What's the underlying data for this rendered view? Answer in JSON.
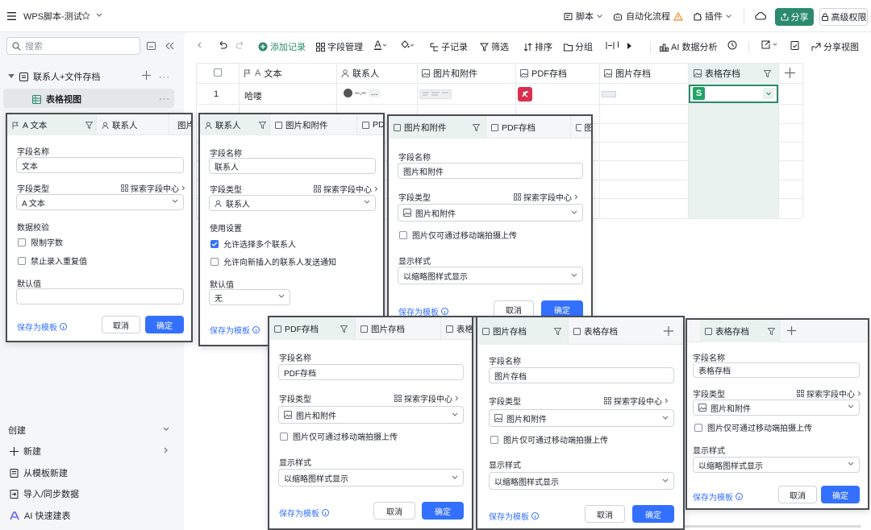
{
  "topbar": {
    "menu_icon": "hamburger-icon",
    "title": "WPS脚本-测试",
    "script": "脚本",
    "automation": "自动化流程",
    "plugin": "插件",
    "share": "分享",
    "permission": "高级权限"
  },
  "sidebar": {
    "search_placeholder": "搜索",
    "table_name": "联系人+文件存档",
    "view_name": "表格视图",
    "create_label": "创建",
    "new_label": "新建",
    "from_template": "从模板新建",
    "import_sync": "导入/同步数据",
    "ai_build": "AI 快速建表"
  },
  "toolbar": {
    "add_record": "添加记录",
    "field_manage": "字段管理",
    "sub_record": "子记录",
    "filter": "筛选",
    "sort": "排序",
    "group": "分组",
    "row_height_partial": "I",
    "ai_analysis": "AI 数据分析",
    "share_view": "分享视图"
  },
  "grid": {
    "headers": [
      "文本",
      "联系人",
      "图片和附件",
      "PDF存档",
      "图片存档",
      "表格存档"
    ],
    "row_number": "1",
    "row_text": "哈喽",
    "contact_text": "–.–",
    "more": "..."
  },
  "panel_text": {
    "tabs": [
      "A 文本",
      "联系人",
      "图片"
    ],
    "field_name_label": "字段名称",
    "field_name_value": "文本",
    "field_type_label": "字段类型",
    "explore": "探索字段中心",
    "field_type_value": "A 文本",
    "validation_label": "数据校验",
    "limit_chars": "限制字数",
    "no_duplicate": "禁止录入重复值",
    "default_label": "默认值",
    "save_template": "保存为模板",
    "cancel": "取消",
    "confirm": "确定"
  },
  "panel_contact": {
    "tabs": [
      "联系人",
      "图片和附件",
      "PD"
    ],
    "field_name_label": "字段名称",
    "field_name_value": "联系人",
    "field_type_label": "字段类型",
    "explore": "探索字段中心",
    "field_type_value": "联系人",
    "usage_label": "使用设置",
    "allow_multi": "允许选择多个联系人",
    "allow_notify": "允许向新插入的联系人发送通知",
    "default_label": "默认值",
    "default_value": "无",
    "save_template": "保存为模板"
  },
  "panel_attach": {
    "tabs": [
      "图片和附件",
      "PDF存档",
      "图"
    ],
    "field_name_label": "字段名称",
    "field_name_value": "图片和附件",
    "field_type_label": "字段类型",
    "explore": "探索字段中心",
    "field_type_value": "图片和附件",
    "mobile_only": "图片仅可通过移动端拍摄上传",
    "display_label": "显示样式",
    "display_value": "以缩略图样式显示",
    "save_template": "保存为模板",
    "cancel": "取消",
    "confirm": "确定"
  },
  "panel_pdf": {
    "tabs": [
      "PDF存档",
      "图片存档",
      "表格"
    ],
    "field_name_label": "字段名称",
    "field_name_value": "PDF存档",
    "field_type_label": "字段类型",
    "explore": "探索字段中心",
    "field_type_value": "图片和附件",
    "mobile_only": "图片仅可通过移动端拍摄上传",
    "display_label": "显示样式",
    "display_value": "以缩略图样式显示",
    "save_template": "保存为模板",
    "cancel": "取消",
    "confirm": "确定"
  },
  "panel_imgarch": {
    "tabs": [
      "图片存档",
      "表格存档"
    ],
    "field_name_label": "字段名称",
    "field_name_value": "图片存档",
    "field_type_label": "字段类型",
    "explore": "探索字段中心",
    "field_type_value": "图片和附件",
    "mobile_only": "图片仅可通过移动端拍摄上传",
    "display_label": "显示样式",
    "display_value": "以缩略图样式显示",
    "save_template": "保存为模板",
    "cancel": "取消",
    "confirm": "确定"
  },
  "panel_sheet": {
    "tabs": [
      "表格存档"
    ],
    "field_name_label": "字段名称",
    "field_name_value": "表格存档",
    "field_type_label": "字段类型",
    "explore": "探索字段中心",
    "field_type_value": "图片和附件",
    "mobile_only": "图片仅可通过移动端拍摄上传",
    "display_label": "显示样式",
    "display_value": "以缩略图样式显示",
    "save_template": "保存为模板",
    "cancel": "取消",
    "confirm": "确定"
  },
  "colors": {
    "accent": "#3370ff",
    "share_green": "#2c8a6e",
    "pdf_red": "#d9304f",
    "sheet_green": "#20a465",
    "warn": "#f08a24"
  }
}
